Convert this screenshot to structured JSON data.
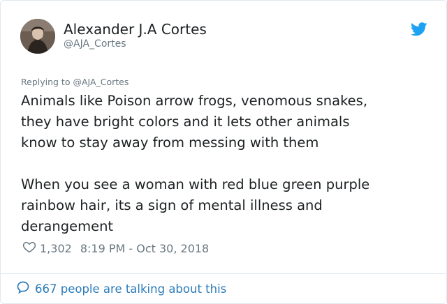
{
  "author": {
    "display_name": "Alexander J.A Cortes",
    "handle": "@AJA_Cortes",
    "avatar_icon": "profile-photo"
  },
  "brand": {
    "icon": "twitter-bird-icon",
    "color": "#1da1f2"
  },
  "tweet": {
    "replying_to": "Replying to @AJA_Cortes",
    "paragraphs": [
      "Animals like Poison arrow frogs, venomous snakes,\nthey have bright colors and it lets other animals\nknow to stay away from messing with them",
      "When you see a woman with red blue green purple\nrainbow hair, its a sign of mental illness and\nderangement"
    ]
  },
  "meta": {
    "like_icon": "heart-outline-icon",
    "likes": "1,302",
    "timestamp": "8:19 PM - Oct 30, 2018"
  },
  "footer": {
    "icon": "speech-bubble-icon",
    "talking_text": "667 people are talking about this",
    "link_color": "#2b7bb9"
  }
}
